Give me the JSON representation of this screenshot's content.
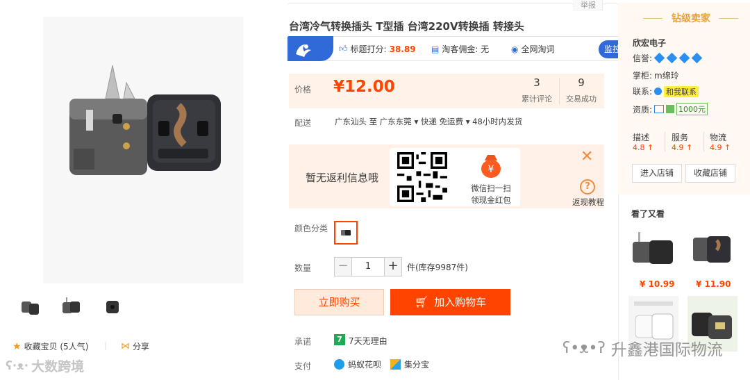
{
  "product": {
    "title": "台湾冷气转换插头 T型插 台湾220V转换插 转接头",
    "report": "举报",
    "stats": {
      "title_score_label": "标题打分:",
      "title_score": "38.89",
      "commission": "淘客佣金: 无",
      "search": "全网淘词",
      "monitor": "监控"
    },
    "price_label": "价格",
    "price": "¥12.00",
    "reviews_count": "3",
    "reviews_label": "累计评论",
    "deals_count": "9",
    "deals_label": "交易成功",
    "delivery_label": "配送",
    "delivery_text": "广东汕头 至  广东东莞 ▾   快递 免运费 ▾   48小时内发货",
    "rebate_text": "暂无返利信息哦",
    "wechat_line1": "微信扫一扫",
    "wechat_line2": "领现金红包",
    "help_label": "返现教程",
    "color_label": "颜色分类",
    "qty_label": "数量",
    "qty_minus": "−",
    "qty_value": "1",
    "qty_plus": "+",
    "stock": "件(库存9987件)",
    "buy_now": "立即购买",
    "add_cart": "加入购物车",
    "promise_label": "承诺",
    "promise_icon": "7",
    "promise_text": "7天无理由",
    "pay_label": "支付",
    "pay_huabei": "蚂蚁花呗",
    "pay_jifen": "集分宝"
  },
  "gallery": {
    "favorite": "收藏宝贝 (5人气)",
    "share": "分享"
  },
  "seller": {
    "badge_title": "钻级卖家",
    "shop_name": "欣宏电子",
    "credit_label": "信誉:",
    "owner_label": "掌柜:",
    "owner": "m绵玲",
    "contact_label": "联系:",
    "contact_btn": "和我联系",
    "qual_label": "资质:",
    "deposit": "1000元",
    "scores": [
      {
        "label": "描述",
        "value": "4.8 ↑"
      },
      {
        "label": "服务",
        "value": "4.9 ↑"
      },
      {
        "label": "物流",
        "value": "4.9 ↑"
      }
    ],
    "enter_shop": "进入店铺",
    "fav_shop": "收藏店铺"
  },
  "recommend": {
    "title": "看了又看",
    "items": [
      {
        "price": "¥ 10.99"
      },
      {
        "price": "¥ 11.90"
      }
    ]
  },
  "watermarks": {
    "left": "大数跨境",
    "right": "升鑫港国际物流"
  },
  "colors": {
    "accent": "#ff4400",
    "uc_blue": "#2f6ad8",
    "price_bg": "#fff2e8"
  }
}
